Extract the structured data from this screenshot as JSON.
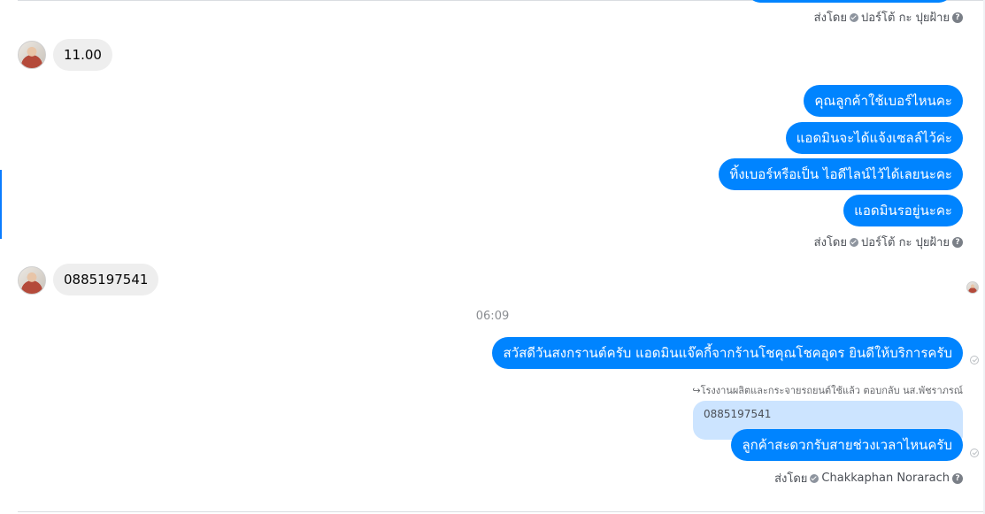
{
  "sender_label": "ส่งโดย",
  "sender_name_1": "ปอร์โต้ กะ ปุยฝ้าย",
  "sender_name_2": "Chakkaphan Norarach",
  "help_icon_glyph": "?",
  "incoming": [
    {
      "text": "11.00"
    },
    {
      "text": "0885197541"
    }
  ],
  "outgoing_group_1": [
    {
      "text": "คุณลูกค้าใช้เบอร์ไหนคะ"
    },
    {
      "text": "แอดมินจะได้แจ้งเซลล์ไว้ค่ะ"
    },
    {
      "text": "ทิ้งเบอร์หรือเป็น ไอดีไลน์ไว้ได้เลยนะคะ"
    },
    {
      "text": "แอดมินรอยู่นะคะ"
    }
  ],
  "timestamp": "06:09",
  "outgoing_group_2": [
    {
      "text": "สวัสดีวันสงกรานต์ครับ แอดมินแจ๊คกี้จากร้านโชคุณโชคอุดร ยินดีให้บริการครับ"
    }
  ],
  "reply_note": "โรงงานผลิตและกระจายรถยนต์ใช้แล้ว ตอบกลับ นส.พัชราภรณ์",
  "quoted_text": "0885197541",
  "reply_message": "ลูกค้าสะดวกรับสายช่วงเวลาไหนครับ",
  "colors": {
    "outgoing_bubble": "#0084ff",
    "incoming_bubble": "#eeeeee",
    "quote_bubble": "#cce4ff"
  }
}
